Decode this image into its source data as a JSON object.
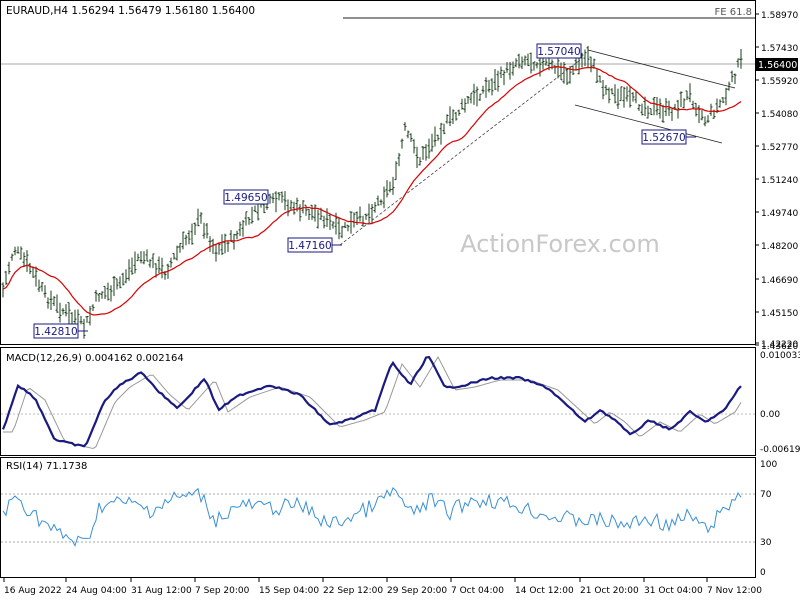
{
  "header": {
    "symbol_line": "EURAUD,H4  1.56294 1.56479 1.56180 1.56400",
    "fe_label": "FE 61.8"
  },
  "watermark": "ActionForex.com",
  "price_axis": {
    "ticks": [
      "1.58970",
      "1.57430",
      "1.55920",
      "1.54080",
      "1.52770",
      "1.51240",
      "1.49740",
      "1.48200",
      "1.46690",
      "1.45150",
      "1.43620",
      "1.42220"
    ],
    "current_label": "1.56400"
  },
  "callouts": [
    {
      "id": "low-aug",
      "text": "1.42810"
    },
    {
      "id": "high-sep",
      "text": "1.49650"
    },
    {
      "id": "low-sep",
      "text": "1.47160"
    },
    {
      "id": "high-oct",
      "text": "1.57040"
    },
    {
      "id": "low-nov",
      "text": "1.52670"
    }
  ],
  "macd": {
    "label": "MACD(12,26,9) 0.004162 0.002164",
    "ticks": [
      "0.010033",
      "0.00",
      "-0.006193"
    ]
  },
  "rsi": {
    "label": "RSI(14) 71.1738",
    "ticks": [
      "100",
      "70",
      "30",
      "0"
    ]
  },
  "time_axis": [
    "16 Aug 2022",
    "24 Aug 04:00",
    "31 Aug 12:00",
    "7 Sep 20:00",
    "15 Sep 04:00",
    "22 Sep 12:00",
    "29 Sep 20:00",
    "7 Oct 04:00",
    "14 Oct 12:00",
    "21 Oct 20:00",
    "31 Oct 04:00",
    "7 Nov 12:00"
  ],
  "colors": {
    "ma": "#d90000",
    "macd": "#1a1a80",
    "signal": "#999999",
    "rsi": "#3a8fd6",
    "candle": "#1a3d1a",
    "callout_text": "#1a1a80"
  },
  "chart_data": [
    {
      "type": "candlestick",
      "title": "EURAUD,H4",
      "ylim": [
        1.4222,
        1.5897
      ],
      "key_levels": [
        {
          "label": "1.42810",
          "value": 1.4281
        },
        {
          "label": "1.49650",
          "value": 1.4965
        },
        {
          "label": "1.47160",
          "value": 1.4716
        },
        {
          "label": "1.57040",
          "value": 1.5704
        },
        {
          "label": "1.52670",
          "value": 1.5267
        },
        {
          "label": "1.56400",
          "value": 1.564
        },
        {
          "label": "FE 61.8",
          "value": 1.5865
        }
      ],
      "series": [
        {
          "name": "price",
          "x": [
            "16 Aug 2022",
            "24 Aug 04:00",
            "31 Aug 12:00",
            "7 Sep 20:00",
            "15 Sep 04:00",
            "22 Sep 12:00",
            "29 Sep 20:00",
            "7 Oct 04:00",
            "14 Oct 12:00",
            "21 Oct 20:00",
            "31 Oct 04:00",
            "7 Nov 12:00"
          ],
          "values": [
            1.458,
            1.433,
            1.462,
            1.479,
            1.488,
            1.479,
            1.512,
            1.533,
            1.566,
            1.548,
            1.54,
            1.564
          ]
        }
      ]
    },
    {
      "type": "line",
      "title": "MACD(12,26,9)",
      "ylim": [
        -0.006193,
        0.010033
      ],
      "series": [
        {
          "name": "MACD",
          "values": [
            0.0015,
            -0.005,
            0.006,
            0.002,
            0.0035,
            -0.001,
            0.0085,
            0.003,
            0.004,
            -0.001,
            -0.0015,
            0.0042
          ]
        }
      ]
    },
    {
      "type": "line",
      "title": "RSI(14)",
      "ylim": [
        0,
        100
      ],
      "series": [
        {
          "name": "RSI",
          "values": [
            60,
            35,
            58,
            68,
            62,
            50,
            72,
            60,
            66,
            50,
            45,
            71
          ]
        }
      ]
    }
  ]
}
